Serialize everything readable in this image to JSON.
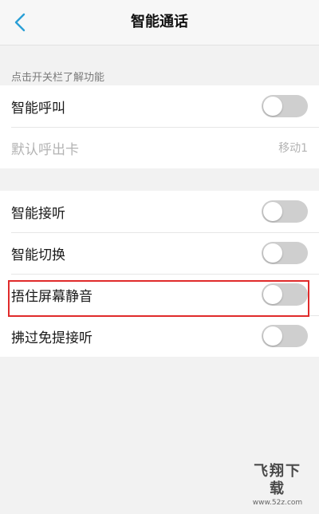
{
  "header": {
    "title": "智能通话",
    "back_icon": "chevron-left-icon"
  },
  "section1": {
    "label": "点击开关栏了解功能",
    "rows": [
      {
        "label": "智能呼叫",
        "toggle_on": false
      },
      {
        "label": "默认呼出卡",
        "value": "移动1"
      }
    ]
  },
  "section2": {
    "rows": [
      {
        "label": "智能接听",
        "toggle_on": false
      },
      {
        "label": "智能切换",
        "toggle_on": false
      },
      {
        "label": "捂住屏幕静音",
        "toggle_on": false,
        "highlighted": true
      },
      {
        "label": "拂过免提接听",
        "toggle_on": false
      }
    ]
  },
  "watermark": {
    "main": "飞翔下载",
    "sub": "www.52z.com"
  },
  "colors": {
    "accent": "#2a9fd6",
    "toggle_off": "#cfcfcf",
    "highlight": "#e02b2b"
  }
}
